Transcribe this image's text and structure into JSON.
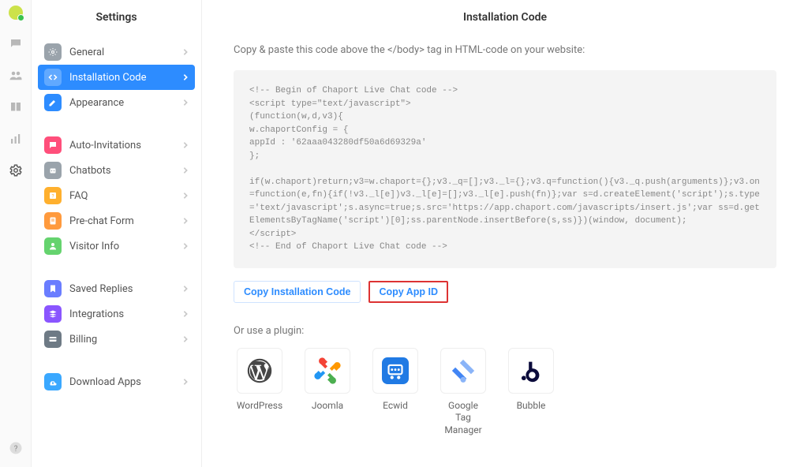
{
  "sidebar": {
    "title": "Settings",
    "groups": [
      [
        {
          "label": "General",
          "iconColor": "#9aa3ab",
          "iconName": "gear-icon"
        },
        {
          "label": "Installation Code",
          "iconColor": "#2d8cff",
          "iconName": "code-icon",
          "active": true
        },
        {
          "label": "Appearance",
          "iconColor": "#2d8cff",
          "iconName": "pencil-icon"
        }
      ],
      [
        {
          "label": "Auto-Invitations",
          "iconColor": "#ff4f7b",
          "iconName": "chat-icon"
        },
        {
          "label": "Chatbots",
          "iconColor": "#9aa3ab",
          "iconName": "bot-icon"
        },
        {
          "label": "FAQ",
          "iconColor": "#ffb02e",
          "iconName": "faq-icon"
        },
        {
          "label": "Pre-chat Form",
          "iconColor": "#ff9a3d",
          "iconName": "form-icon"
        },
        {
          "label": "Visitor Info",
          "iconColor": "#65d36e",
          "iconName": "visitor-icon"
        }
      ],
      [
        {
          "label": "Saved Replies",
          "iconColor": "#6a7dff",
          "iconName": "bookmark-icon"
        },
        {
          "label": "Integrations",
          "iconColor": "#8a55ff",
          "iconName": "stack-icon"
        },
        {
          "label": "Billing",
          "iconColor": "#6e7a85",
          "iconName": "card-icon"
        }
      ],
      [
        {
          "label": "Download Apps",
          "iconColor": "#3aa8ff",
          "iconName": "download-icon"
        }
      ]
    ]
  },
  "main": {
    "title": "Installation Code",
    "intro": "Copy & paste this code above the </body> tag in HTML-code on your website:",
    "code": "<!-- Begin of Chaport Live Chat code -->\n<script type=\"text/javascript\">\n(function(w,d,v3){\nw.chaportConfig = {\nappId : '62aaa043280df50a6d69329a'\n};\n\nif(w.chaport)return;v3=w.chaport={};v3._q=[];v3._l={};v3.q=function(){v3._q.push(arguments)};v3.on=function(e,fn){if(!v3._l[e])v3._l[e]=[];v3._l[e].push(fn)};var s=d.createElement('script');s.type='text/javascript';s.async=true;s.src='https://app.chaport.com/javascripts/insert.js';var ss=d.getElementsByTagName('script')[0];ss.parentNode.insertBefore(s,ss)})(window, document);\n</script>\n<!-- End of Chaport Live Chat code -->",
    "copyCodeBtn": "Copy Installation Code",
    "copyAppIdBtn": "Copy App ID",
    "pluginsLabel": "Or use a plugin:",
    "plugins": [
      {
        "label": "WordPress",
        "iconName": "wordpress-icon"
      },
      {
        "label": "Joomla",
        "iconName": "joomla-icon"
      },
      {
        "label": "Ecwid",
        "iconName": "ecwid-icon"
      },
      {
        "label": "Google\nTag Manager",
        "iconName": "gtm-icon"
      },
      {
        "label": "Bubble",
        "iconName": "bubble-icon"
      }
    ]
  }
}
